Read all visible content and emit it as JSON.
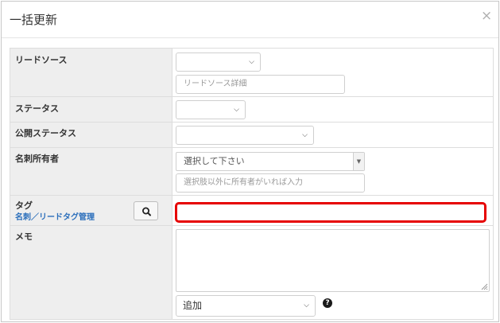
{
  "dialog": {
    "title": "一括更新",
    "close_glyph": "×"
  },
  "fields": {
    "lead_source": {
      "label": "リードソース",
      "selected": "",
      "detail_placeholder": "リードソース詳細"
    },
    "status": {
      "label": "ステータス",
      "selected": ""
    },
    "public_status": {
      "label": "公開ステータス",
      "selected": ""
    },
    "card_owner": {
      "label": "名刺所有者",
      "combo_value": "選択して下さい",
      "other_placeholder": "選択肢以外に所有者がいれば入力"
    },
    "tag": {
      "label": "タグ",
      "manage_link": "名刺／リードタグ管理",
      "value": "",
      "highlight_color": "#e60000"
    },
    "memo": {
      "label": "メモ",
      "value": "",
      "mode_selected": "追加",
      "help_glyph": "?"
    }
  },
  "icons": {
    "close": "close-icon",
    "search": "search-icon",
    "help": "help-icon",
    "chevron": "chevron-down-icon",
    "resize": "resize-handle-icon"
  },
  "colors": {
    "label_bg": "#eeeeee",
    "link": "#2a6ebb",
    "highlight": "#e60000"
  }
}
